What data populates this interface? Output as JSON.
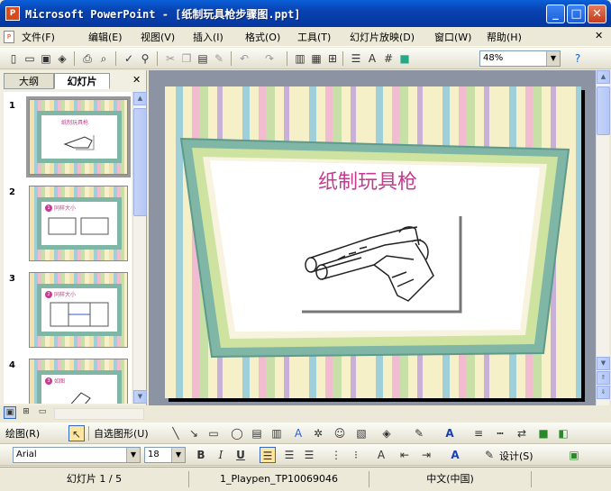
{
  "window": {
    "title": "Microsoft PowerPoint - [纸制玩具枪步骤图.ppt]",
    "app_icon": "P",
    "buttons": {
      "minimize": "_",
      "maximize": "□",
      "close": "✕"
    }
  },
  "menu": {
    "items": [
      "文件(F)",
      "编辑(E)",
      "视图(V)",
      "插入(I)",
      "格式(O)",
      "工具(T)",
      "幻灯片放映(D)",
      "窗口(W)",
      "帮助(H)"
    ],
    "close_doc": "✕"
  },
  "standard_toolbar": {
    "zoom": "48%"
  },
  "left_pane": {
    "tabs": [
      "大纲",
      "幻灯片"
    ],
    "active_tab": "幻灯片",
    "close": "✕",
    "slides": [
      {
        "number": "1",
        "title": "纸制玩具枪"
      },
      {
        "number": "2",
        "title": "同样大小"
      },
      {
        "number": "3",
        "title": "同样大小"
      },
      {
        "number": "4",
        "title": "如图"
      }
    ]
  },
  "slide": {
    "title": "纸制玩具枪",
    "colors": {
      "title": "#c43b8f",
      "frame": "#7fb6a6",
      "frame_inner": "#cfe3a0"
    }
  },
  "drawing_toolbar": {
    "draw_label": "绘图(R)",
    "autoshapes_label": "自选图形(U)"
  },
  "formatting_toolbar": {
    "font": "Arial",
    "size": "18",
    "design_label": "设计(S)"
  },
  "status_bar": {
    "slide": "幻灯片 1 / 5",
    "template": "1_Playpen_TP10069046",
    "language": "中文(中国)"
  }
}
